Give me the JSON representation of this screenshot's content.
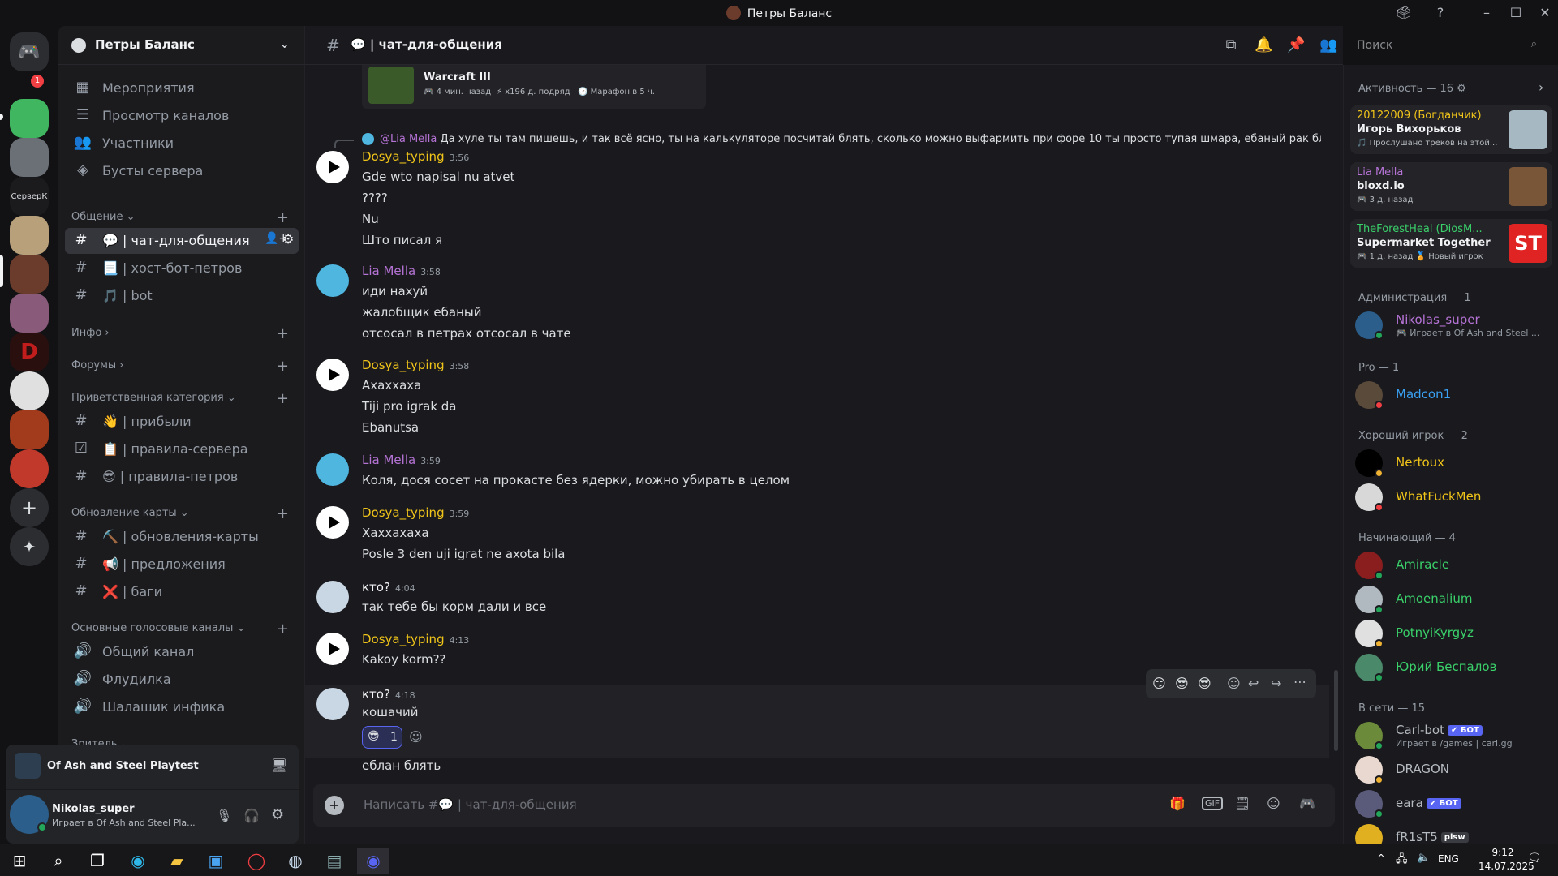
{
  "window": {
    "title": "Петры Баланс"
  },
  "server": {
    "name": "Петры Баланс",
    "top_items": [
      "Мероприятия",
      "Просмотр каналов",
      "Участники",
      "Бусты сервера"
    ],
    "categories": [
      {
        "name": "Общение ⌄",
        "channels": [
          "💬 | чат-для-общения",
          "📃 | хост-бот-петров",
          "🎵 | bot"
        ]
      },
      {
        "name": "Инфо ›"
      },
      {
        "name": "Форумы ›"
      },
      {
        "name": "Приветственная категория ⌄",
        "channels": [
          "👋 | прибыли",
          "📋 | правила-сервера",
          "😎 | правила-петров"
        ]
      },
      {
        "name": "Обновление карты ⌄",
        "channels": [
          "⛏️ | обновления-карты",
          "📢 | предложения",
          "❌ | баги"
        ]
      },
      {
        "name": "Основные голосовые каналы ⌄",
        "voice": [
          "Общий канал",
          "Флудилка",
          "Шалашик инфика"
        ]
      },
      {
        "name": "Зритель ⌄"
      }
    ],
    "guild_label_server_k": "СерверК",
    "notification_badge": "1"
  },
  "activity_panel": {
    "game": "Of Ash and Steel Playtest"
  },
  "user": {
    "name": "Nikolas_super",
    "status": "Играет в Of Ash and Steel Pla..."
  },
  "chat": {
    "channel": "💬 | чат-для-общения",
    "search_placeholder": "Поиск",
    "composer_placeholder": "Написать #💬 | чат-для-общения",
    "embed": {
      "game": "Warcraft III",
      "info1": "🎮 4 мин. назад",
      "info2": "⚡ x196 д. подряд",
      "info3": "🕑 Марафон в 5 ч."
    },
    "reply": {
      "mention": "@Lia Mella",
      "text": "Да хуле ты там пишешь, и так всё ясно, ты на калькуляторе посчитай блять, сколько можно выфармить при форе 10 ты просто тупая шмара, ебаный рак блять, сколько под..."
    },
    "messages": [
      {
        "author": "Dosya_typing",
        "time": "3:56",
        "lines": [
          "Gde wto napisal nu atvet",
          "????",
          "Nu",
          "Што писал я"
        ]
      },
      {
        "author": "Lia Mella",
        "time": "3:58",
        "lines": [
          "иди нахуй",
          "жалобщик ебаный",
          "отсосал в петрах отсосал в чате"
        ]
      },
      {
        "author": "Dosya_typing",
        "time": "3:58",
        "lines": [
          "Ахаххаха",
          "Tiji pro igrak da",
          "Ebanutsa"
        ]
      },
      {
        "author": "Lia Mella",
        "time": "3:59",
        "lines": [
          "Коля, дося сосет на прокасте без ядерки, можно убирать в целом"
        ]
      },
      {
        "author": "Dosya_typing",
        "time": "3:59",
        "lines": [
          "Хаххахаха",
          "Posle 3 den uji igrat ne axota bila"
        ]
      },
      {
        "author": "кто?",
        "time": "4:04",
        "lines": [
          "так тебе бы корм дали и все"
        ]
      },
      {
        "author": "Dosya_typing",
        "time": "4:13",
        "lines": [
          "Kakoy korm??"
        ]
      },
      {
        "author": "кто?",
        "time": "4:18",
        "lines": [
          "кошачий"
        ],
        "reaction": "1"
      },
      {
        "author": "",
        "time": "",
        "lines": [
          "еблан блять"
        ]
      }
    ]
  },
  "members": {
    "activity_header": "Активность — 16 ⚙",
    "activity": [
      {
        "user": "20122009 (Богданчик)",
        "title": "Игорь Вихорьков",
        "sub": "🎵 Прослушано треков на этой..."
      },
      {
        "user": "Lia Mella",
        "title": "bloxd.io",
        "sub": "🎮 3 д. назад"
      },
      {
        "user": "TheForestHeal (DiosM...",
        "title": "Supermarket Together",
        "sub": "🎮 1 д. назад   🏅 Новый игрок",
        "thumb_text": "ST"
      }
    ],
    "groups": [
      {
        "header": "Администрация — 1",
        "members": [
          {
            "name": "Nikolas_super",
            "sub": "🎮 Играет в Of Ash and Steel ..."
          }
        ]
      },
      {
        "header": "Pro — 1",
        "members": [
          {
            "name": "Madcon1",
            "sub": ""
          }
        ]
      },
      {
        "header": "Хороший игрок — 2",
        "members": [
          {
            "name": "Nertoux",
            "sub": ""
          },
          {
            "name": "WhatFuckMen",
            "sub": ""
          }
        ]
      },
      {
        "header": "Начинающий — 4",
        "members": [
          {
            "name": "Amiracle",
            "sub": ""
          },
          {
            "name": "Amoenalium",
            "sub": ""
          },
          {
            "name": "PotnyiKyrgyz",
            "sub": ""
          },
          {
            "name": "Юрий Беспалов",
            "sub": ""
          }
        ]
      },
      {
        "header": "В сети — 15",
        "members": [
          {
            "name": "Carl-bot",
            "sub": "Играет в /games | carl.gg",
            "badge": "✔ БОТ"
          },
          {
            "name": "DRAGON",
            "sub": ""
          },
          {
            "name": "eara",
            "sub": "",
            "badge": "✔ БОТ"
          },
          {
            "name": "fR1sT5",
            "sub": "",
            "badge": "plsw"
          }
        ]
      }
    ]
  },
  "taskbar": {
    "lang": "ENG",
    "time": "9:12",
    "date": "14.07.2025"
  },
  "colors": {
    "accent": "#5865f2",
    "dosya": "#f0c419",
    "lia": "#b673d6",
    "admin": "#b673d6",
    "pro": "#3aa0f2",
    "good": "#f0c419",
    "beginner": "#3ad06a"
  }
}
